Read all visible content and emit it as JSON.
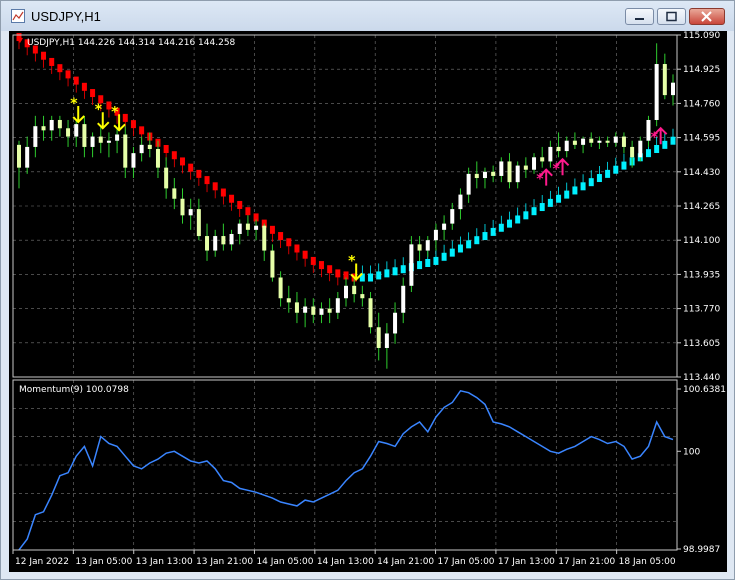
{
  "window": {
    "title": "USDJPY,H1",
    "buttons": [
      "minimize",
      "restore",
      "close"
    ]
  },
  "chart_data": [
    {
      "type": "candlestick",
      "info_line": "USDJPY,H1  144.226 144.314 144.216 144.258",
      "ylim": [
        113.44,
        115.09
      ],
      "y_ticks": [
        "115.090",
        "114.925",
        "114.760",
        "114.595",
        "114.430",
        "114.265",
        "114.100",
        "113.935",
        "113.770",
        "113.605",
        "113.440"
      ],
      "grid": true,
      "colors": {
        "bull": "#ffffff",
        "bear": "#e6ffa8",
        "wick": "#2ecc2e",
        "trend_down": "#ff0000",
        "trend_up": "#00f0ff",
        "signal_sell": "#ffff00",
        "signal_buy": "#ff1a8c"
      },
      "candles": [
        [
          114.56,
          114.58,
          114.35,
          114.45
        ],
        [
          114.45,
          114.6,
          114.42,
          114.55
        ],
        [
          114.55,
          114.7,
          114.5,
          114.65
        ],
        [
          114.65,
          114.7,
          114.58,
          114.63
        ],
        [
          114.63,
          114.7,
          114.58,
          114.68
        ],
        [
          114.68,
          114.7,
          114.6,
          114.64
        ],
        [
          114.64,
          114.68,
          114.55,
          114.6
        ],
        [
          114.6,
          114.68,
          114.55,
          114.66
        ],
        [
          114.66,
          114.7,
          114.5,
          114.55
        ],
        [
          114.55,
          114.62,
          114.5,
          114.6
        ],
        [
          114.6,
          114.65,
          114.52,
          114.57
        ],
        [
          114.57,
          114.62,
          114.5,
          114.58
        ],
        [
          114.58,
          114.64,
          114.52,
          114.61
        ],
        [
          114.61,
          114.65,
          114.4,
          114.45
        ],
        [
          114.45,
          114.55,
          114.4,
          114.52
        ],
        [
          114.52,
          114.6,
          114.48,
          114.56
        ],
        [
          114.56,
          114.62,
          114.5,
          114.54
        ],
        [
          114.54,
          114.58,
          114.4,
          114.45
        ],
        [
          114.45,
          114.5,
          114.3,
          114.35
        ],
        [
          114.35,
          114.4,
          114.25,
          114.3
        ],
        [
          114.3,
          114.35,
          114.18,
          114.22
        ],
        [
          114.22,
          114.3,
          114.15,
          114.25
        ],
        [
          114.25,
          114.3,
          114.1,
          114.12
        ],
        [
          114.12,
          114.18,
          114.0,
          114.05
        ],
        [
          114.05,
          114.15,
          114.02,
          114.12
        ],
        [
          114.12,
          114.18,
          114.05,
          114.08
        ],
        [
          114.08,
          114.15,
          114.05,
          114.13
        ],
        [
          114.13,
          114.2,
          114.08,
          114.18
        ],
        [
          114.18,
          114.22,
          114.12,
          114.15
        ],
        [
          114.15,
          114.2,
          114.1,
          114.17
        ],
        [
          114.17,
          114.18,
          114.0,
          114.05
        ],
        [
          114.05,
          114.08,
          113.9,
          113.92
        ],
        [
          113.92,
          113.95,
          113.78,
          113.82
        ],
        [
          113.82,
          113.88,
          113.75,
          113.8
        ],
        [
          113.8,
          113.85,
          113.7,
          113.75
        ],
        [
          113.75,
          113.82,
          113.68,
          113.78
        ],
        [
          113.78,
          113.82,
          113.7,
          113.74
        ],
        [
          113.74,
          113.8,
          113.7,
          113.77
        ],
        [
          113.77,
          113.82,
          113.7,
          113.75
        ],
        [
          113.75,
          113.85,
          113.72,
          113.82
        ],
        [
          113.82,
          113.92,
          113.78,
          113.88
        ],
        [
          113.88,
          113.92,
          113.8,
          113.84
        ],
        [
          113.84,
          113.88,
          113.78,
          113.82
        ],
        [
          113.82,
          113.85,
          113.65,
          113.68
        ],
        [
          113.68,
          113.75,
          113.52,
          113.58
        ],
        [
          113.58,
          113.7,
          113.48,
          113.65
        ],
        [
          113.65,
          113.8,
          113.6,
          113.75
        ],
        [
          113.75,
          113.92,
          113.7,
          113.88
        ],
        [
          113.88,
          114.12,
          113.85,
          114.08
        ],
        [
          114.08,
          114.12,
          114.0,
          114.05
        ],
        [
          114.05,
          114.12,
          114.02,
          114.1
        ],
        [
          114.1,
          114.18,
          114.05,
          114.15
        ],
        [
          114.15,
          114.22,
          114.1,
          114.18
        ],
        [
          114.18,
          114.28,
          114.15,
          114.25
        ],
        [
          114.25,
          114.35,
          114.2,
          114.32
        ],
        [
          114.32,
          114.45,
          114.28,
          114.42
        ],
        [
          114.42,
          114.48,
          114.35,
          114.4
        ],
        [
          114.4,
          114.45,
          114.35,
          114.43
        ],
        [
          114.43,
          114.46,
          114.38,
          114.41
        ],
        [
          114.41,
          114.5,
          114.38,
          114.48
        ],
        [
          114.48,
          114.52,
          114.35,
          114.38
        ],
        [
          114.38,
          114.48,
          114.35,
          114.46
        ],
        [
          114.46,
          114.5,
          114.4,
          114.44
        ],
        [
          114.44,
          114.52,
          114.42,
          114.5
        ],
        [
          114.5,
          114.55,
          114.45,
          114.48
        ],
        [
          114.48,
          114.58,
          114.45,
          114.55
        ],
        [
          114.55,
          114.62,
          114.5,
          114.53
        ],
        [
          114.53,
          114.6,
          114.5,
          114.58
        ],
        [
          114.58,
          114.62,
          114.54,
          114.56
        ],
        [
          114.56,
          114.6,
          114.52,
          114.59
        ],
        [
          114.59,
          114.62,
          114.55,
          114.57
        ],
        [
          114.57,
          114.6,
          114.54,
          114.58
        ],
        [
          114.58,
          114.6,
          114.55,
          114.57
        ],
        [
          114.57,
          114.62,
          114.55,
          114.6
        ],
        [
          114.6,
          114.62,
          114.52,
          114.55
        ],
        [
          114.55,
          114.58,
          114.45,
          114.5
        ],
        [
          114.5,
          114.6,
          114.48,
          114.58
        ],
        [
          114.58,
          114.7,
          114.55,
          114.68
        ],
        [
          114.68,
          115.05,
          114.65,
          114.95
        ],
        [
          114.95,
          115.0,
          114.78,
          114.8
        ],
        [
          114.8,
          114.9,
          114.75,
          114.86
        ]
      ],
      "trend_values": [
        115.08,
        115.05,
        115.02,
        114.99,
        114.96,
        114.93,
        114.9,
        114.87,
        114.84,
        114.81,
        114.78,
        114.75,
        114.72,
        114.69,
        114.66,
        114.63,
        114.6,
        114.57,
        114.54,
        114.51,
        114.48,
        114.45,
        114.42,
        114.39,
        114.36,
        114.33,
        114.3,
        114.27,
        114.24,
        114.21,
        114.18,
        114.15,
        114.12,
        114.09,
        114.06,
        114.03,
        114.0,
        113.98,
        113.96,
        113.94,
        113.93,
        113.92,
        113.92,
        113.92,
        113.93,
        113.94,
        113.95,
        113.96,
        113.97,
        113.98,
        113.99,
        114.0,
        114.02,
        114.04,
        114.06,
        114.08,
        114.1,
        114.12,
        114.14,
        114.16,
        114.18,
        114.2,
        114.22,
        114.24,
        114.26,
        114.28,
        114.3,
        114.32,
        114.34,
        114.36,
        114.38,
        114.4,
        114.42,
        114.44,
        114.46,
        114.48,
        114.5,
        114.52,
        114.54,
        114.56,
        114.58
      ],
      "trend_switch_index": 42,
      "sell_signal_indices": [
        7,
        10,
        12,
        41
      ],
      "buy_signal_indices": [
        64,
        66,
        78
      ]
    },
    {
      "type": "line",
      "name": "Momentum(9) 100.0798",
      "ylim": [
        98.9987,
        100.6381
      ],
      "y_ticks": [
        "100.6381",
        "100",
        "98.9987"
      ],
      "color": "#3a85ff",
      "values": [
        98.99,
        99.1,
        99.35,
        99.38,
        99.55,
        99.75,
        99.78,
        99.95,
        100.05,
        99.85,
        100.15,
        100.08,
        100.05,
        99.95,
        99.85,
        99.82,
        99.88,
        99.92,
        99.98,
        100.0,
        99.95,
        99.9,
        99.88,
        99.9,
        99.82,
        99.7,
        99.68,
        99.62,
        99.6,
        99.58,
        99.55,
        99.52,
        99.48,
        99.46,
        99.44,
        99.5,
        99.48,
        99.52,
        99.56,
        99.6,
        99.7,
        99.78,
        99.82,
        99.95,
        100.1,
        100.08,
        100.05,
        100.18,
        100.25,
        100.3,
        100.2,
        100.35,
        100.45,
        100.5,
        100.62,
        100.6,
        100.55,
        100.48,
        100.3,
        100.28,
        100.25,
        100.2,
        100.15,
        100.1,
        100.05,
        100.0,
        99.98,
        100.02,
        100.05,
        100.1,
        100.15,
        100.12,
        100.08,
        100.1,
        100.05,
        99.92,
        99.95,
        100.05,
        100.3,
        100.15,
        100.12
      ]
    }
  ],
  "x_axis": {
    "labels": [
      "12 Jan 2022",
      "13 Jan 05:00",
      "13 Jan 13:00",
      "13 Jan 21:00",
      "14 Jan 05:00",
      "14 Jan 13:00",
      "14 Jan 21:00",
      "17 Jan 05:00",
      "17 Jan 13:00",
      "17 Jan 21:00",
      "18 Jan 05:00"
    ]
  }
}
